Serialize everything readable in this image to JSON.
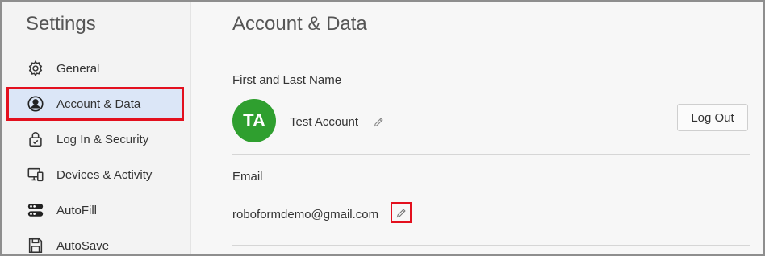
{
  "sidebar": {
    "title": "Settings",
    "items": [
      {
        "label": "General",
        "icon": "gear-icon"
      },
      {
        "label": "Account & Data",
        "icon": "user-circle-icon",
        "selected": true
      },
      {
        "label": "Log In & Security",
        "icon": "lock-icon"
      },
      {
        "label": "Devices & Activity",
        "icon": "devices-icon"
      },
      {
        "label": "AutoFill",
        "icon": "autofill-icon"
      },
      {
        "label": "AutoSave",
        "icon": "save-icon"
      }
    ]
  },
  "main": {
    "title": "Account & Data",
    "name_section": {
      "label": "First and Last Name",
      "avatar_initials": "TA",
      "avatar_color": "#2f9f2f",
      "name": "Test Account",
      "logout_label": "Log Out"
    },
    "email_section": {
      "label": "Email",
      "value": "roboformdemo@gmail.com"
    }
  },
  "colors": {
    "highlight_border": "#e3101e",
    "selected_bg": "#dbe6f7"
  }
}
